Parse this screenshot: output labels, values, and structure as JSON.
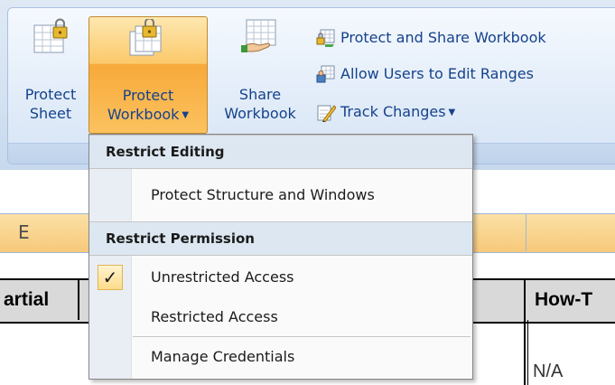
{
  "ribbon": {
    "protect_sheet": {
      "line1": "Protect",
      "line2": "Sheet",
      "icon": "lock-sheet-icon"
    },
    "protect_workbook": {
      "line1": "Protect",
      "line2": "Workbook",
      "icon": "lock-workbook-icon"
    },
    "share_workbook": {
      "line1": "Share",
      "line2": "Workbook",
      "icon": "share-workbook-icon"
    },
    "protect_and_share": {
      "label": "Protect and Share Workbook",
      "icon": "protect-share-icon"
    },
    "allow_users": {
      "label": "Allow Users to Edit Ranges",
      "icon": "allow-edit-ranges-icon"
    },
    "track_changes": {
      "label": "Track Changes",
      "icon": "track-changes-icon"
    }
  },
  "sheet": {
    "column_letter": "E",
    "header_partial": "artial",
    "header_howt": "How-T",
    "cell_na": "N/A"
  },
  "menu": {
    "section1": "Restrict Editing",
    "item_protect_structure": "Protect Structure and Windows",
    "section2": "Restrict Permission",
    "item_unrestricted": "Unrestricted Access",
    "item_restricted": "Restricted Access",
    "item_manage": "Manage Credentials",
    "checked_item": "Unrestricted Access",
    "check_glyph": "✓"
  },
  "colors": {
    "ribbon_text": "#15428b",
    "active_button": "#fbc96a",
    "column_header": "#f7c97a"
  }
}
